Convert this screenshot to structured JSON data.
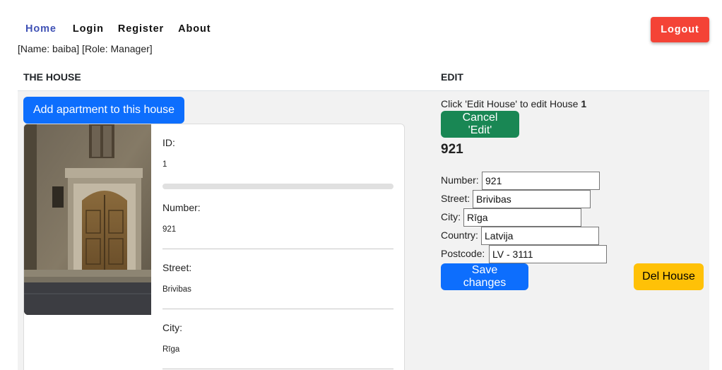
{
  "nav": {
    "home": "Home",
    "login": "Login",
    "register": "Register",
    "about": "About",
    "logout": "Logout"
  },
  "user_info": "[Name: baiba] [Role: Manager]",
  "table": {
    "left_header": "THE HOUSE",
    "right_header": "EDIT"
  },
  "house": {
    "add_apartment_label": "Add apartment to this house",
    "fields": [
      {
        "label": "ID:",
        "value": "1"
      },
      {
        "label": "Number:",
        "value": "921"
      },
      {
        "label": "Street:",
        "value": "Brivibas"
      },
      {
        "label": "City:",
        "value": "Rīga"
      }
    ]
  },
  "edit": {
    "hint_prefix": "Click 'Edit House' to edit House ",
    "hint_id": "1",
    "cancel_label": "Cancel 'Edit'",
    "heading": "921",
    "form": {
      "number_label": "Number:",
      "number_value": "921",
      "street_label": "Street:",
      "street_value": "Brivibas",
      "city_label": "City:",
      "city_value": "Rīga",
      "country_label": "Country:",
      "country_value": "Latvija",
      "postcode_label": "Postcode:",
      "postcode_value": "LV - 3111"
    },
    "save_label": "Save changes",
    "delete_label": "Del House"
  },
  "colors": {
    "nav_active": "#3f51b5",
    "logout": "#f44336",
    "primary": "#0d6efd",
    "success": "#198754",
    "warning": "#ffc107",
    "panel_bg": "#f2f2f2"
  }
}
